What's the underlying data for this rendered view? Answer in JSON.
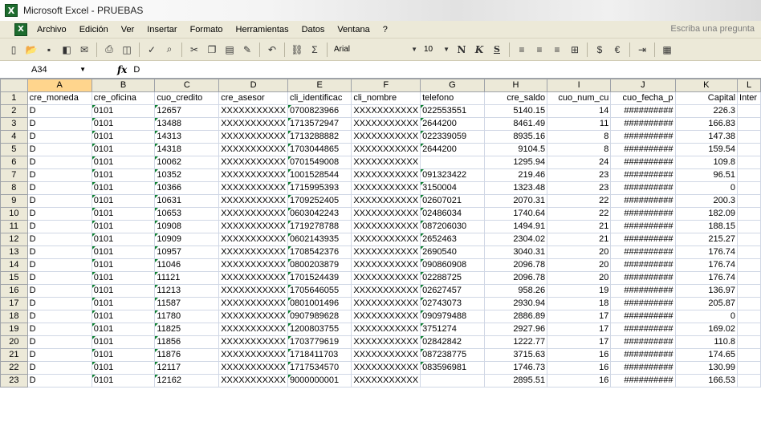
{
  "window": {
    "title": "Microsoft Excel - PRUEBAS",
    "app_icon": "excel-icon"
  },
  "menu": {
    "items": [
      "Archivo",
      "Edición",
      "Ver",
      "Insertar",
      "Formato",
      "Herramientas",
      "Datos",
      "Ventana",
      "?"
    ],
    "ask_placeholder": "Escriba una pregunta"
  },
  "toolbar": {
    "font_name": "Arial",
    "font_size": "10",
    "bold_label": "N",
    "italic_label": "K",
    "underline_label": "S",
    "sum_symbol": "Σ",
    "euro_symbol": "€"
  },
  "formula_bar": {
    "name_box": "A34",
    "fx_label": "fx",
    "value": "D"
  },
  "grid": {
    "selected_column": "A",
    "columns": [
      "A",
      "B",
      "C",
      "D",
      "E",
      "F",
      "G",
      "H",
      "I",
      "J",
      "K",
      "L"
    ],
    "header_row": [
      "cre_moneda",
      "cre_oficina",
      "cuo_credito",
      "cre_asesor",
      "cli_identificac",
      "cli_nombre",
      "telefono",
      "cre_saldo",
      "cuo_num_cu",
      "cuo_fecha_p",
      "Capital",
      "Inter"
    ],
    "rows": [
      [
        "D",
        "0101",
        "12657",
        "XXXXXXXXXXX",
        "0700823966",
        "XXXXXXXXXXX",
        "022553551",
        "5140.15",
        "14",
        "##########",
        "226.3",
        ""
      ],
      [
        "D",
        "0101",
        "13488",
        "XXXXXXXXXXX",
        "1713572947",
        "XXXXXXXXXXX",
        "2644200",
        "8461.49",
        "11",
        "##########",
        "166.83",
        ""
      ],
      [
        "D",
        "0101",
        "14313",
        "XXXXXXXXXXX",
        "1713288882",
        "XXXXXXXXXXX",
        "022339059",
        "8935.16",
        "8",
        "##########",
        "147.38",
        ""
      ],
      [
        "D",
        "0101",
        "14318",
        "XXXXXXXXXXX",
        "1703044865",
        "XXXXXXXXXXX",
        "2644200",
        "9104.5",
        "8",
        "##########",
        "159.54",
        ""
      ],
      [
        "D",
        "0101",
        "10062",
        "XXXXXXXXXXX",
        "0701549008",
        "XXXXXXXXXXX",
        "",
        "1295.94",
        "24",
        "##########",
        "109.8",
        ""
      ],
      [
        "D",
        "0101",
        "10352",
        "XXXXXXXXXXX",
        "1001528544",
        "XXXXXXXXXXX",
        "091323422",
        "219.46",
        "23",
        "##########",
        "96.51",
        ""
      ],
      [
        "D",
        "0101",
        "10366",
        "XXXXXXXXXXX",
        "1715995393",
        "XXXXXXXXXXX",
        "3150004",
        "1323.48",
        "23",
        "##########",
        "0",
        ""
      ],
      [
        "D",
        "0101",
        "10631",
        "XXXXXXXXXXX",
        "1709252405",
        "XXXXXXXXXXX",
        "02607021",
        "2070.31",
        "22",
        "##########",
        "200.3",
        ""
      ],
      [
        "D",
        "0101",
        "10653",
        "XXXXXXXXXXX",
        "0603042243",
        "XXXXXXXXXXX",
        "02486034",
        "1740.64",
        "22",
        "##########",
        "182.09",
        ""
      ],
      [
        "D",
        "0101",
        "10908",
        "XXXXXXXXXXX",
        "1719278788",
        "XXXXXXXXXXX",
        "087206030",
        "1494.91",
        "21",
        "##########",
        "188.15",
        ""
      ],
      [
        "D",
        "0101",
        "10909",
        "XXXXXXXXXXX",
        "0602143935",
        "XXXXXXXXXXX",
        "2652463",
        "2304.02",
        "21",
        "##########",
        "215.27",
        ""
      ],
      [
        "D",
        "0101",
        "10957",
        "XXXXXXXXXXX",
        "1708542376",
        "XXXXXXXXXXX",
        "2690540",
        "3040.31",
        "20",
        "##########",
        "176.74",
        ""
      ],
      [
        "D",
        "0101",
        "11046",
        "XXXXXXXXXXX",
        "0800203879",
        "XXXXXXXXXXX",
        "090860908",
        "2096.78",
        "20",
        "##########",
        "176.74",
        ""
      ],
      [
        "D",
        "0101",
        "11121",
        "XXXXXXXXXXX",
        "1701524439",
        "XXXXXXXXXXX",
        "02288725",
        "2096.78",
        "20",
        "##########",
        "176.74",
        ""
      ],
      [
        "D",
        "0101",
        "11213",
        "XXXXXXXXXXX",
        "1705646055",
        "XXXXXXXXXXX",
        "02627457",
        "958.26",
        "19",
        "##########",
        "136.97",
        ""
      ],
      [
        "D",
        "0101",
        "11587",
        "XXXXXXXXXXX",
        "0801001496",
        "XXXXXXXXXXX",
        "02743073",
        "2930.94",
        "18",
        "##########",
        "205.87",
        ""
      ],
      [
        "D",
        "0101",
        "11780",
        "XXXXXXXXXXX",
        "0907989628",
        "XXXXXXXXXXX",
        "090979488",
        "2886.89",
        "17",
        "##########",
        "0",
        ""
      ],
      [
        "D",
        "0101",
        "11825",
        "XXXXXXXXXXX",
        "1200803755",
        "XXXXXXXXXXX",
        "3751274",
        "2927.96",
        "17",
        "##########",
        "169.02",
        ""
      ],
      [
        "D",
        "0101",
        "11856",
        "XXXXXXXXXXX",
        "1703779619",
        "XXXXXXXXXXX",
        "02842842",
        "1222.77",
        "17",
        "##########",
        "110.8",
        ""
      ],
      [
        "D",
        "0101",
        "11876",
        "XXXXXXXXXXX",
        "1718411703",
        "XXXXXXXXXXX",
        "087238775",
        "3715.63",
        "16",
        "##########",
        "174.65",
        ""
      ],
      [
        "D",
        "0101",
        "12117",
        "XXXXXXXXXXX",
        "1717534570",
        "XXXXXXXXXXX",
        "083596981",
        "1746.73",
        "16",
        "##########",
        "130.99",
        ""
      ],
      [
        "D",
        "0101",
        "12162",
        "XXXXXXXXXXX",
        "9000000001",
        "XXXXXXXXXXX",
        "",
        "2895.51",
        "16",
        "##########",
        "166.53",
        ""
      ]
    ]
  }
}
